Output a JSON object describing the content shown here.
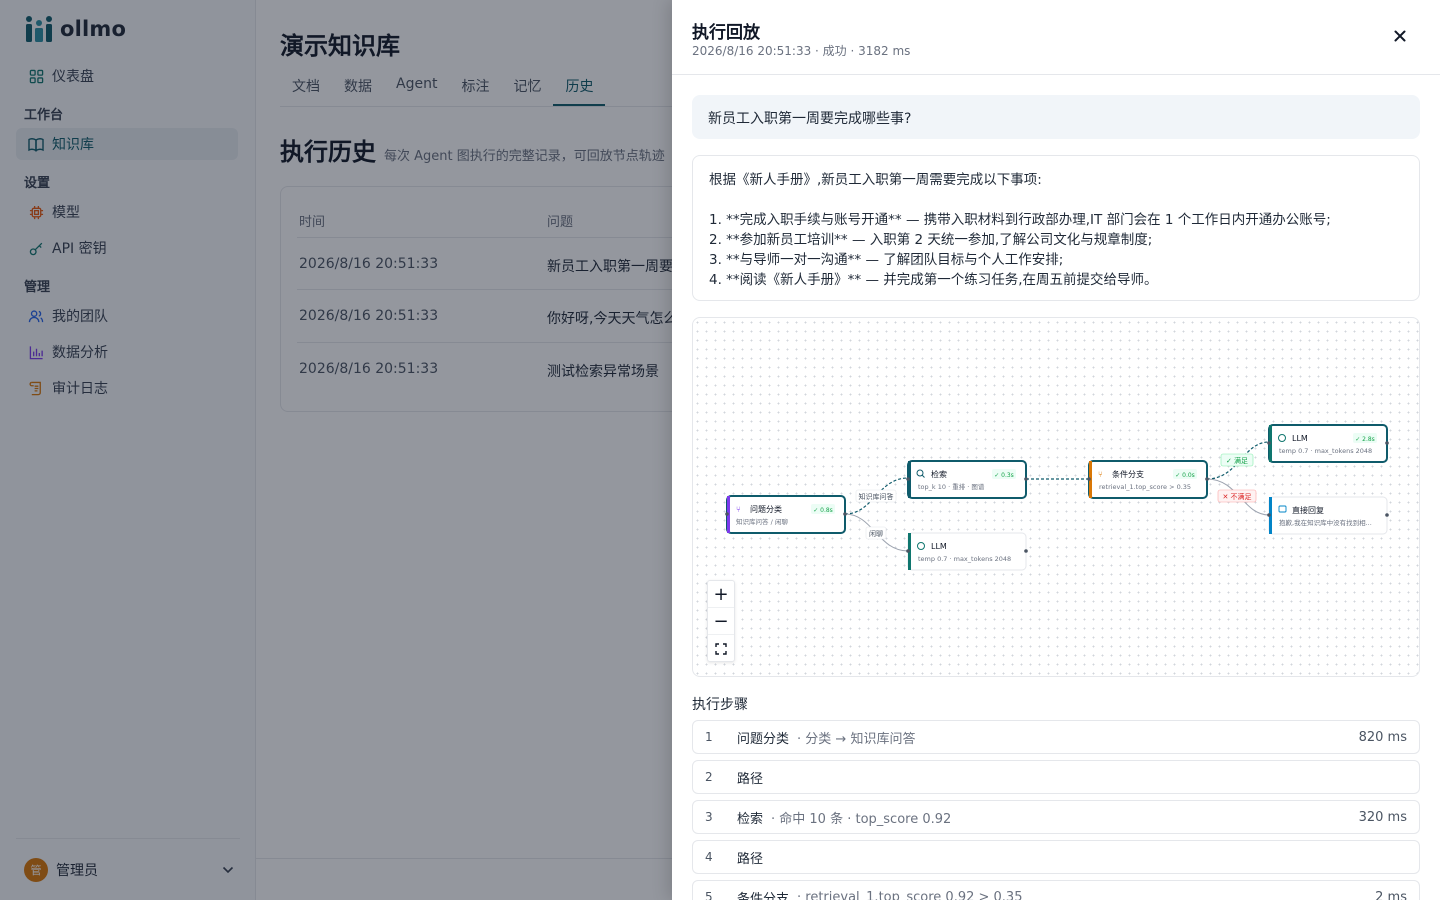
{
  "app": {
    "name": "ollmo"
  },
  "sidebar": {
    "dashboard": "仪表盘",
    "section_workbench": "工作台",
    "knowledge_base": "知识库",
    "section_settings": "设置",
    "models": "模型",
    "api_keys": "API 密钥",
    "section_admin": "管理",
    "my_team": "我的团队",
    "analytics": "数据分析",
    "audit_log": "审计日志",
    "user": {
      "avatar": "管",
      "name": "管理员"
    }
  },
  "main": {
    "title": "演示知识库",
    "tabs": [
      "文档",
      "数据",
      "Agent",
      "标注",
      "记忆",
      "历史"
    ],
    "active_tab": "历史",
    "section_title": "执行历史",
    "section_desc": "每次 Agent 图执行的完整记录，可回放节点轨迹",
    "table": {
      "headers": [
        "时间",
        "问题"
      ],
      "rows": [
        {
          "time": "2026/8/16 20:51:33",
          "question": "新员工入职第一周要"
        },
        {
          "time": "2026/8/16 20:51:33",
          "question": "你好呀,今天天气怎么"
        },
        {
          "time": "2026/8/16 20:51:33",
          "question": "测试检索异常场景"
        }
      ]
    }
  },
  "drawer": {
    "title": "执行回放",
    "subtitle": "2026/8/16 20:51:33 · 成功 · 3182 ms",
    "question": "新员工入职第一周要完成哪些事?",
    "answer": [
      "根据《新人手册》,新员工入职第一周需要完成以下事项:",
      "",
      "1. **完成入职手续与账号开通** — 携带入职材料到行政部办理,IT 部门会在 1 个工作日内开通办公账号;",
      "2. **参加新员工培训** — 入职第 2 天统一参加,了解公司文化与规章制度;",
      "3. **与导师一对一沟通** — 了解团队目标与个人工作安排;",
      "4. **阅读《新人手册》** — 并完成第一个练习任务,在周五前提交给导师。"
    ],
    "graph": {
      "nodes": [
        {
          "id": "classify",
          "icon": "classify-icon",
          "title": "问题分类",
          "badge": "✓ 0.8s",
          "sub": "知识库问答 / 闲聊",
          "color": "#7c3aed",
          "active": true
        },
        {
          "id": "retrieve",
          "icon": "search-icon",
          "title": "检索",
          "badge": "✓ 0.3s",
          "sub": "top_k 10 · 重排 · 图谱",
          "color": "#0f5b6b",
          "active": true
        },
        {
          "id": "llm_chat",
          "icon": "llm-icon",
          "title": "LLM",
          "badge": "",
          "sub": "temp 0.7 · max_tokens 2048",
          "color": "#0f766e",
          "active": false
        },
        {
          "id": "condition",
          "icon": "branch-icon",
          "title": "条件分支",
          "badge": "✓ 0.0s",
          "sub": "retrieval_1.top_score > 0.35",
          "color": "#d97706",
          "active": true
        },
        {
          "id": "llm_answer",
          "icon": "llm-icon",
          "title": "LLM",
          "badge": "✓ 2.8s",
          "sub": "temp 0.7 · max_tokens 2048",
          "color": "#0f766e",
          "active": true
        },
        {
          "id": "direct_reply",
          "icon": "chat-icon",
          "title": "直接回复",
          "badge": "",
          "sub": "抱歉,我在知识库中没有找到相...",
          "color": "#0284c7",
          "active": false
        }
      ],
      "edge_labels": {
        "kb_qa": "知识库问答",
        "chitchat": "闲聊",
        "satisfied": "✓ 满足",
        "not_satisfied": "✕ 不满足"
      },
      "zoom_in": "+",
      "zoom_out": "−",
      "fit": "⛶"
    },
    "steps_title": "执行步骤",
    "steps": [
      {
        "num": "1",
        "name": "问题分类",
        "detail": "· 分类 → 知识库问答",
        "dur": "820 ms"
      },
      {
        "num": "2",
        "name": "路径",
        "detail": "",
        "dur": ""
      },
      {
        "num": "3",
        "name": "检索",
        "detail": "· 命中 10 条 · top_score 0.92",
        "dur": "320 ms"
      },
      {
        "num": "4",
        "name": "路径",
        "detail": "",
        "dur": ""
      },
      {
        "num": "5",
        "name": "条件分支",
        "detail": "· retrieval_1.top_score 0.92 > 0.35",
        "dur": "2 ms"
      }
    ],
    "colors": {
      "accent": "#0f5b6b",
      "success": "#16a34a",
      "danger": "#dc2626"
    }
  }
}
